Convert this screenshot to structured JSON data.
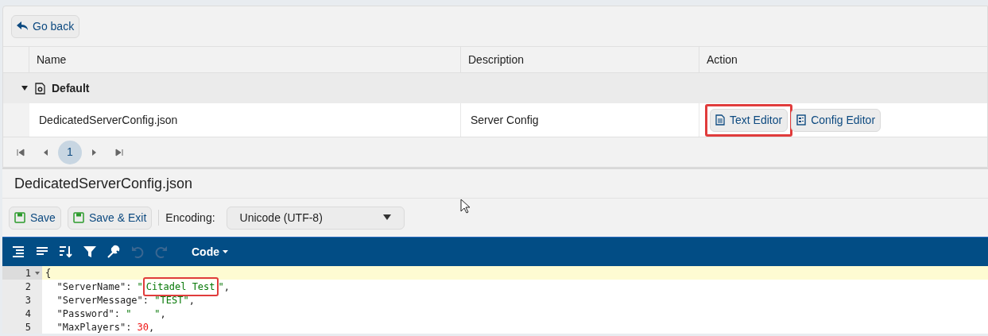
{
  "back_button": {
    "label": "Go back"
  },
  "table": {
    "columns": [
      "Name",
      "Description",
      "Action"
    ],
    "groups": [
      {
        "label": "Default",
        "expanded": true,
        "rows": [
          {
            "name": "DedicatedServerConfig.json",
            "description": "Server Config",
            "actions": [
              {
                "label": "Text Editor",
                "kind": "text",
                "highlighted": true
              },
              {
                "label": "Config Editor",
                "kind": "config",
                "highlighted": false
              }
            ]
          }
        ]
      }
    ]
  },
  "pager": {
    "pages": [
      {
        "label": "1",
        "selected": true
      }
    ]
  },
  "editor": {
    "title": "DedicatedServerConfig.json",
    "buttons": [
      {
        "label": "Save"
      },
      {
        "label": "Save & Exit"
      }
    ],
    "encoding": {
      "label": "Encoding:",
      "value": "Unicode (UTF-8)"
    },
    "tools": [
      {
        "kind": "format",
        "disabled": false
      },
      {
        "kind": "compact",
        "disabled": false
      },
      {
        "kind": "sort",
        "disabled": false
      },
      {
        "kind": "filter",
        "disabled": false
      },
      {
        "kind": "repair",
        "disabled": false
      },
      {
        "kind": "undo",
        "disabled": true
      },
      {
        "kind": "redo",
        "disabled": true
      }
    ],
    "mode": "Code",
    "lines": [
      {
        "number": "1",
        "active": true,
        "foldable": true,
        "tokens": [
          {
            "kind": "punct",
            "text": "{"
          }
        ]
      },
      {
        "number": "2",
        "active": false,
        "foldable": false,
        "tokens": [
          {
            "kind": "key",
            "text": "\"ServerName\""
          },
          {
            "kind": "punct",
            "text": ": "
          },
          {
            "kind": "string",
            "text": "\""
          },
          {
            "kind": "string",
            "text": "Citadel Test",
            "highlighted": true
          },
          {
            "kind": "string",
            "text": "\""
          },
          {
            "kind": "punct",
            "text": ","
          }
        ]
      },
      {
        "number": "3",
        "active": false,
        "foldable": false,
        "tokens": [
          {
            "kind": "key",
            "text": "\"ServerMessage\""
          },
          {
            "kind": "punct",
            "text": ": "
          },
          {
            "kind": "string",
            "text": "\"TEST\""
          },
          {
            "kind": "punct",
            "text": ","
          }
        ]
      },
      {
        "number": "4",
        "active": false,
        "foldable": false,
        "tokens": [
          {
            "kind": "key",
            "text": "\"Password\""
          },
          {
            "kind": "punct",
            "text": ": "
          },
          {
            "kind": "string",
            "text": "\"    \""
          },
          {
            "kind": "punct",
            "text": ","
          }
        ]
      },
      {
        "number": "5",
        "active": false,
        "foldable": false,
        "tokens": [
          {
            "kind": "key",
            "text": "\"MaxPlayers\""
          },
          {
            "kind": "punct",
            "text": ": "
          },
          {
            "kind": "number",
            "text": "30"
          },
          {
            "kind": "punct",
            "text": ","
          }
        ]
      }
    ]
  }
}
